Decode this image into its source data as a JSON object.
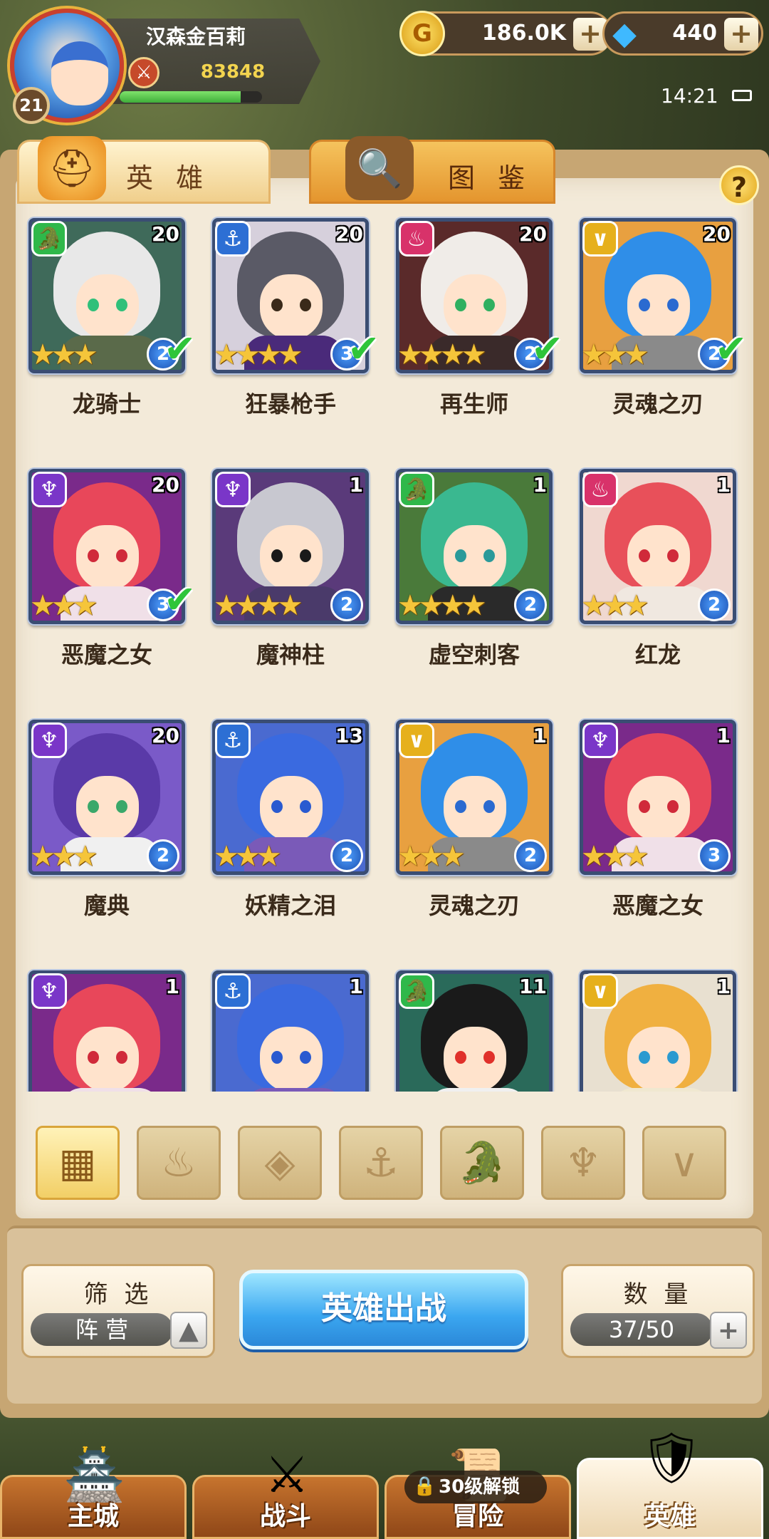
{
  "player": {
    "name": "汉森金百莉",
    "level": "21",
    "power": "83848",
    "xp_fraction": 0.85
  },
  "resources": {
    "gold": "186.0K",
    "gems": "440"
  },
  "status": {
    "time": "14:21"
  },
  "tabs": [
    {
      "label": "英 雄",
      "active": true
    },
    {
      "label": "图 鉴",
      "active": false
    }
  ],
  "help_label": "?",
  "factions": {
    "dragon": {
      "color": "#2fb84a",
      "glyph": "dragon-icon"
    },
    "anchor": {
      "color": "#2d6fd4",
      "glyph": "anchor-icon"
    },
    "flame": {
      "color": "#d8326a",
      "glyph": "flame-icon"
    },
    "wing": {
      "color": "#e6b01c",
      "glyph": "chevron-wing-icon"
    },
    "demon": {
      "color": "#7a36c8",
      "glyph": "demon-horns-icon"
    }
  },
  "heroes": [
    {
      "name": "龙骑士",
      "level": "20",
      "stars": 3,
      "rank": "2",
      "faction": "dragon",
      "check": true,
      "hair": "#e8e8e8",
      "bg": "#3f6a5a",
      "eye": "#2fc07a",
      "body": "#5a6a4a"
    },
    {
      "name": "狂暴枪手",
      "level": "20",
      "stars": 4,
      "rank": "3",
      "faction": "anchor",
      "check": true,
      "hair": "#5a5a66",
      "bg": "#d6d0dc",
      "eye": "#3a2a1a",
      "body": "#4a2a7a"
    },
    {
      "name": "再生师",
      "level": "20",
      "stars": 4,
      "rank": "2",
      "faction": "flame",
      "check": true,
      "hair": "#f0ece8",
      "bg": "#5a2a2a",
      "eye": "#2fb060",
      "body": "#3a2a2a"
    },
    {
      "name": "灵魂之刃",
      "level": "20",
      "stars": 3,
      "rank": "2",
      "faction": "wing",
      "check": true,
      "hair": "#2f8ee8",
      "bg": "#e8a040",
      "eye": "#2a6ad0",
      "body": "#8a8a8a"
    },
    {
      "name": "恶魔之女",
      "level": "20",
      "stars": 3,
      "rank": "3",
      "faction": "demon",
      "check": true,
      "hair": "#e8475a",
      "bg": "#7a2a8a",
      "eye": "#d02a3a",
      "body": "#f0e0e8"
    },
    {
      "name": "魔神柱",
      "level": "1",
      "stars": 4,
      "rank": "2",
      "faction": "demon",
      "check": false,
      "hair": "#c8c8d0",
      "bg": "#5a3a7a",
      "eye": "#1a1a1a",
      "body": "#4a3a6a"
    },
    {
      "name": "虚空刺客",
      "level": "1",
      "stars": 4,
      "rank": "2",
      "faction": "dragon",
      "check": false,
      "hair": "#3ab890",
      "bg": "#4a7a3a",
      "eye": "#2a9a9a",
      "body": "#2a2a2a"
    },
    {
      "name": "红龙",
      "level": "1",
      "stars": 3,
      "rank": "2",
      "faction": "flame",
      "check": false,
      "hair": "#e8505a",
      "bg": "#f0d8d0",
      "eye": "#d02a3a",
      "body": "#f0e8e0"
    },
    {
      "name": "魔典",
      "level": "20",
      "stars": 3,
      "rank": "2",
      "faction": "demon",
      "check": false,
      "hair": "#5a3aa8",
      "bg": "#7a5ac8",
      "eye": "#3aa86a",
      "body": "#f0f0f0"
    },
    {
      "name": "妖精之泪",
      "level": "13",
      "stars": 3,
      "rank": "2",
      "faction": "anchor",
      "check": false,
      "hair": "#3a6ae0",
      "bg": "#4a6ad0",
      "eye": "#2a5ad0",
      "body": "#7a5ab8"
    },
    {
      "name": "灵魂之刃",
      "level": "1",
      "stars": 3,
      "rank": "2",
      "faction": "wing",
      "check": false,
      "hair": "#2f8ee8",
      "bg": "#e8a040",
      "eye": "#2a6ad0",
      "body": "#8a8a8a"
    },
    {
      "name": "恶魔之女",
      "level": "1",
      "stars": 3,
      "rank": "3",
      "faction": "demon",
      "check": false,
      "hair": "#e8475a",
      "bg": "#7a2a8a",
      "eye": "#d02a3a",
      "body": "#f0e0e8"
    },
    {
      "name": "",
      "level": "1",
      "stars": 0,
      "rank": "",
      "faction": "demon",
      "check": false,
      "hair": "#e8475a",
      "bg": "#7a2a8a",
      "eye": "#d02a3a",
      "body": "#f0e0e8"
    },
    {
      "name": "",
      "level": "1",
      "stars": 0,
      "rank": "",
      "faction": "anchor",
      "check": false,
      "hair": "#3a6ae0",
      "bg": "#4a6ad0",
      "eye": "#2a5ad0",
      "body": "#7a5ab8"
    },
    {
      "name": "",
      "level": "11",
      "stars": 0,
      "rank": "",
      "faction": "dragon",
      "check": false,
      "hair": "#1a1a1a",
      "bg": "#2a6a5a",
      "eye": "#e0302a",
      "body": "#f0f0f0"
    },
    {
      "name": "",
      "level": "1",
      "stars": 0,
      "rank": "",
      "faction": "wing",
      "check": false,
      "hair": "#f0b040",
      "bg": "#e8e0d0",
      "eye": "#2a9ad0",
      "body": "#f0e8d0"
    }
  ],
  "faction_filters": [
    {
      "icon": "grid-all-icon",
      "active": true
    },
    {
      "icon": "flame-icon",
      "active": false
    },
    {
      "icon": "diamond-icon",
      "active": false
    },
    {
      "icon": "anchor-icon",
      "active": false
    },
    {
      "icon": "dragon-icon",
      "active": false
    },
    {
      "icon": "demon-horns-icon",
      "active": false
    },
    {
      "icon": "chevron-wing-icon",
      "active": false
    }
  ],
  "filter_panel": {
    "title": "筛 选",
    "value": "阵 营"
  },
  "deploy_button": "英雄出战",
  "count_panel": {
    "title": "数 量",
    "value": "37/50"
  },
  "bottom_nav": [
    {
      "label": "主城",
      "icon": "castle-icon",
      "active": false
    },
    {
      "label": "战斗",
      "icon": "crossed-swords-icon",
      "active": false
    },
    {
      "label": "冒险",
      "icon": "map-scroll-icon",
      "active": false,
      "lock": "30级解锁"
    },
    {
      "label": "英雄",
      "icon": "hero-helmet-icon",
      "active": true
    }
  ]
}
